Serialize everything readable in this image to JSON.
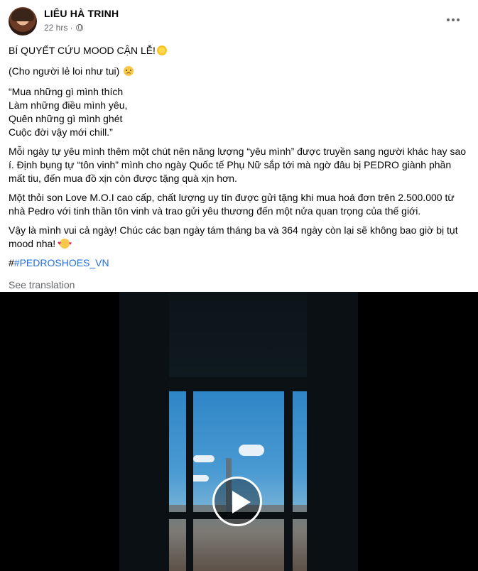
{
  "post": {
    "author": "LIÊU HÀ TRINH",
    "time": "22 hrs ·",
    "title_line": "BÍ QUYẾT CỨU MOOD CẬN LỄ!",
    "subtitle_line": "(Cho người lẻ loi như tui)",
    "quote": "“Mua những gì mình thích\nLàm những điều mình yêu,\nQuên những gì mình ghét\nCuộc đời vậy mới chill.”",
    "para1": "Mỗi ngày tự yêu mình thêm một chút nên năng lượng “yêu mình” được truyền sang người khác hay sao í. Định bụng tự “tôn vinh” mình cho ngày Quốc tế Phụ Nữ sắp tới mà ngờ đâu bị PEDRO giành phần mất tiu, đến mua đồ xịn còn được tặng quà xịn hơn.",
    "para2": "Một thỏi son Love M.O.I cao cấp, chất lượng uy tín được gửi tặng khi mua hoá đơn trên 2.500.000 từ nhà Pedro với tinh thần tôn vinh và trao gửi yêu thương đến một nửa quan trọng của thế giới.",
    "para3": "Vậy là mình vui cả ngày! Chúc các bạn ngày tám tháng ba và 364 ngày còn lại sẽ không bao giờ bị tụt mood nha!",
    "hashtag_prefix": "#",
    "hashtag": "#PEDROSHOES_VN",
    "see_translation": "See translation"
  },
  "icons": {
    "more": "more-options-icon",
    "privacy": "globe-icon",
    "play": "play-icon"
  }
}
